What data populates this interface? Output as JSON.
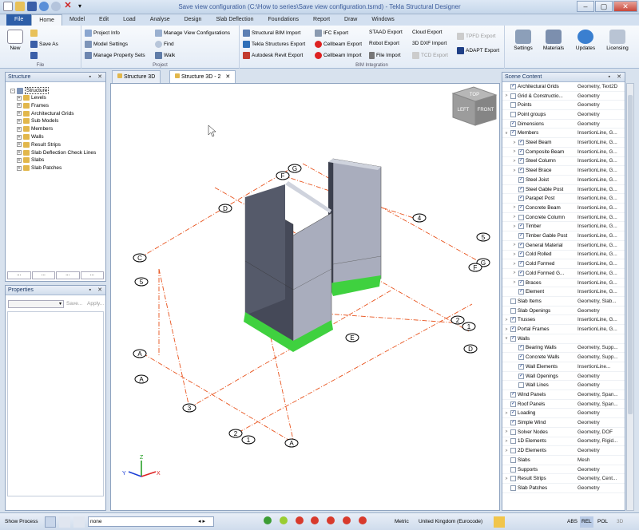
{
  "window": {
    "title": "Save view configuration (C:\\How to series\\Save view configuration.tsmd) - Tekla Structural Designer"
  },
  "tabs": [
    {
      "label": "File"
    },
    {
      "label": "Home"
    },
    {
      "label": "Model"
    },
    {
      "label": "Edit"
    },
    {
      "label": "Load"
    },
    {
      "label": "Analyse"
    },
    {
      "label": "Design"
    },
    {
      "label": "Slab Deflection"
    },
    {
      "label": "Foundations"
    },
    {
      "label": "Report"
    },
    {
      "label": "Draw"
    },
    {
      "label": "Windows"
    }
  ],
  "ribbon": {
    "file_group": {
      "label": "File",
      "new": "New",
      "save_as": "Save As"
    },
    "project_group": {
      "label": "Project",
      "project_info": "Project Info",
      "model_settings": "Model Settings",
      "manage_property_sets": "Manage Property Sets",
      "manage_view_configurations": "Manage View Configurations",
      "find": "Find",
      "walk": "Walk"
    },
    "bim_group": {
      "label": "BIM Integration",
      "structural_bim_import": "Structural BIM Import",
      "tekla_structures_export": "Tekla Structures Export",
      "autodesk_revit_export": "Autodesk Revit Export",
      "ifc_export": "IFC Export",
      "cellbeam_export": "Cellbeam Export",
      "cellbeam_import": "Cellbeam Import",
      "staad_export": "STAAD Export",
      "robot_export": "Robot Export",
      "file_import": "File Import",
      "cloud_export": "Cloud Export",
      "dxf_import": "3D DXF Import",
      "tcd_export": "TCD Export",
      "tpfd_export": "TPFD Export",
      "adapt_export": "ADAPT Export"
    },
    "settings": "Settings",
    "materials": "Materials",
    "updates": "Updates",
    "licensing": "Licensing"
  },
  "structure_panel": {
    "title": "Structure",
    "root": "Structure",
    "items": [
      "Levels",
      "Frames",
      "Architectural Grids",
      "Sub Models",
      "Members",
      "Walls",
      "Result Strips",
      "Slab Deflection Check Lines",
      "Slabs",
      "Slab Patches"
    ],
    "tab_buttons": [
      "...",
      "...",
      "...",
      "..."
    ]
  },
  "properties_panel": {
    "title": "Properties",
    "save": "Save...",
    "apply": "Apply..."
  },
  "view_tabs": [
    {
      "label": "Structure 3D"
    },
    {
      "label": "Structure 3D - 2"
    }
  ],
  "view_cube": {
    "top": "TOP",
    "left": "LEFT",
    "front": "FRONT"
  },
  "grid_labels": [
    "C",
    "D",
    "E",
    "F",
    "G",
    "A",
    "1",
    "2",
    "3",
    "4",
    "5"
  ],
  "axes": {
    "x": "X",
    "y": "Y",
    "z": "Z"
  },
  "scene_panel": {
    "title": "Scene Content",
    "rows": [
      {
        "indent": 0,
        "exp": "",
        "checked": true,
        "name": "Architectural Grids",
        "type": "Geometry, Text2D"
      },
      {
        "indent": 0,
        "exp": ">",
        "checked": false,
        "name": "Grid & Constructio...",
        "type": "Geometry"
      },
      {
        "indent": 0,
        "exp": "",
        "checked": false,
        "name": "Points",
        "type": "Geometry"
      },
      {
        "indent": 0,
        "exp": "",
        "checked": false,
        "name": "Point groups",
        "type": "Geometry"
      },
      {
        "indent": 0,
        "exp": "",
        "checked": true,
        "name": "Dimensions",
        "type": "Geometry"
      },
      {
        "indent": 0,
        "exp": "v",
        "checked": true,
        "name": "Members",
        "type": "InsertionLine, G..."
      },
      {
        "indent": 1,
        "exp": ">",
        "checked": true,
        "name": "Steel Beam",
        "type": "InsertionLine, G..."
      },
      {
        "indent": 1,
        "exp": ">",
        "checked": true,
        "name": "Composite Beam",
        "type": "InsertionLine, G..."
      },
      {
        "indent": 1,
        "exp": ">",
        "checked": true,
        "name": "Steel Column",
        "type": "InsertionLine, G..."
      },
      {
        "indent": 1,
        "exp": ">",
        "checked": true,
        "name": "Steel Brace",
        "type": "InsertionLine, G..."
      },
      {
        "indent": 1,
        "exp": "",
        "checked": true,
        "name": "Steel Joist",
        "type": "InsertionLine, G..."
      },
      {
        "indent": 1,
        "exp": "",
        "checked": true,
        "name": "Steel Gable Post",
        "type": "InsertionLine, G..."
      },
      {
        "indent": 1,
        "exp": "",
        "checked": true,
        "name": "Parapet Post",
        "type": "InsertionLine, G..."
      },
      {
        "indent": 1,
        "exp": ">",
        "checked": true,
        "name": "Concrete Beam",
        "type": "InsertionLine, G..."
      },
      {
        "indent": 1,
        "exp": ">",
        "checked": false,
        "name": "Concrete Column",
        "type": "InsertionLine, G..."
      },
      {
        "indent": 1,
        "exp": ">",
        "checked": true,
        "name": "Timber",
        "type": "InsertionLine, G..."
      },
      {
        "indent": 1,
        "exp": "",
        "checked": true,
        "name": "Timber Gable Post",
        "type": "InsertionLine, G..."
      },
      {
        "indent": 1,
        "exp": ">",
        "checked": true,
        "name": "General Material",
        "type": "InsertionLine, G..."
      },
      {
        "indent": 1,
        "exp": ">",
        "checked": true,
        "name": "Cold Rolled",
        "type": "InsertionLine, G..."
      },
      {
        "indent": 1,
        "exp": ">",
        "checked": true,
        "name": "Cold Formed",
        "type": "InsertionLine, G..."
      },
      {
        "indent": 1,
        "exp": ">",
        "checked": true,
        "name": "Cold Formed G...",
        "type": "InsertionLine, G..."
      },
      {
        "indent": 1,
        "exp": ">",
        "checked": true,
        "name": "Braces",
        "type": "InsertionLine, G..."
      },
      {
        "indent": 1,
        "exp": "",
        "checked": true,
        "name": "Element",
        "type": "InsertionLine, G..."
      },
      {
        "indent": 0,
        "exp": "",
        "checked": false,
        "name": "Slab Items",
        "type": "Geometry, Slab..."
      },
      {
        "indent": 0,
        "exp": "",
        "checked": false,
        "name": "Slab Openings",
        "type": "Geometry"
      },
      {
        "indent": 0,
        "exp": ">",
        "checked": true,
        "name": "Trusses",
        "type": "InsertionLine, G..."
      },
      {
        "indent": 0,
        "exp": ">",
        "checked": true,
        "name": "Portal Frames",
        "type": "InsertionLine, G..."
      },
      {
        "indent": 0,
        "exp": "v",
        "checked": true,
        "name": "Walls",
        "type": ""
      },
      {
        "indent": 1,
        "exp": "",
        "checked": true,
        "name": "Bearing Walls",
        "type": "Geometry, Supp..."
      },
      {
        "indent": 1,
        "exp": "",
        "checked": true,
        "name": "Concrete Walls",
        "type": "Geometry, Supp..."
      },
      {
        "indent": 1,
        "exp": "",
        "checked": true,
        "name": "Wall Elements",
        "type": "InsertionLine..."
      },
      {
        "indent": 1,
        "exp": "",
        "checked": true,
        "name": "Wall Openings",
        "type": "Geometry"
      },
      {
        "indent": 1,
        "exp": "",
        "checked": false,
        "name": "Wall Lines",
        "type": "Geometry"
      },
      {
        "indent": 0,
        "exp": "",
        "checked": true,
        "name": "Wind Panels",
        "type": "Geometry, Span..."
      },
      {
        "indent": 0,
        "exp": "",
        "checked": true,
        "name": "Roof Panels",
        "type": "Geometry, Span..."
      },
      {
        "indent": 0,
        "exp": ">",
        "checked": true,
        "name": "Loading",
        "type": "Geometry"
      },
      {
        "indent": 0,
        "exp": "",
        "checked": true,
        "name": "Simple Wind",
        "type": "Geometry"
      },
      {
        "indent": 0,
        "exp": ">",
        "checked": false,
        "name": "Solver Nodes",
        "type": "Geometry, DOF"
      },
      {
        "indent": 0,
        "exp": ">",
        "checked": false,
        "name": "1D Elements",
        "type": "Geometry, Rigid..."
      },
      {
        "indent": 0,
        "exp": ">",
        "checked": false,
        "name": "2D Elements",
        "type": "Geometry"
      },
      {
        "indent": 0,
        "exp": "",
        "checked": false,
        "name": "Slabs",
        "type": "Mesh"
      },
      {
        "indent": 0,
        "exp": "",
        "checked": false,
        "name": "Supports",
        "type": "Geometry"
      },
      {
        "indent": 0,
        "exp": ">",
        "checked": false,
        "name": "Result Strips",
        "type": "Geometry, Cent..."
      },
      {
        "indent": 0,
        "exp": "",
        "checked": false,
        "name": "Slab Patches",
        "type": "Geometry"
      }
    ]
  },
  "statusbar": {
    "show_process": "Show Process",
    "filter_value": "none",
    "units": "Metric",
    "code": "United Kingdom (Eurocode)",
    "abs": "ABS",
    "rel": "REL",
    "pol": "POL",
    "three_d": "3D"
  },
  "colors": {
    "accent": "#2d5ea8",
    "wall": "#a9adbd",
    "support": "#3fd13f",
    "grid": "#e8531d"
  }
}
